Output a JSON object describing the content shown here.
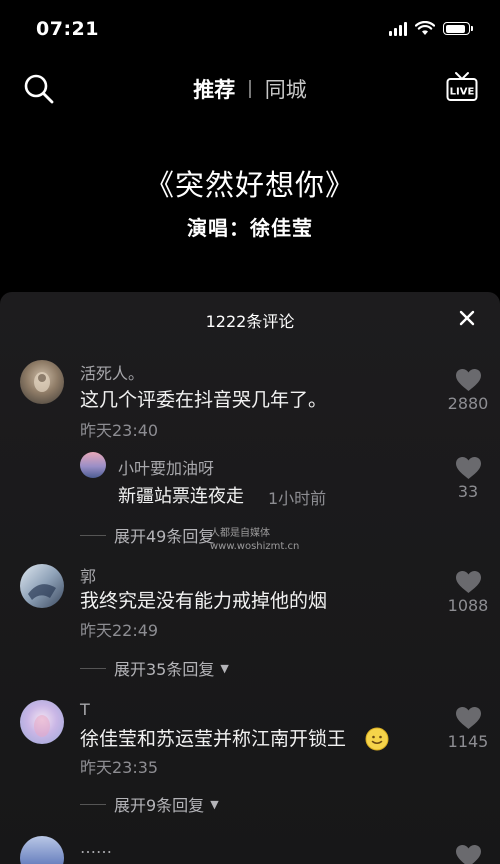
{
  "status_bar": {
    "time": "07:21",
    "battery_level": 0.9
  },
  "nav": {
    "tabs": [
      {
        "label": "推荐",
        "active": true
      },
      {
        "label": "同城",
        "active": false
      }
    ],
    "live_icon_text": "LIVE"
  },
  "song": {
    "title": "《突然好想你》",
    "singer": "演唱：徐佳莹"
  },
  "comments_panel": {
    "count_label": "1222条评论",
    "comments": [
      {
        "username": "活死人。",
        "text": "这几个评委在抖音哭几年了。",
        "time": "昨天23:40",
        "likes": "2880"
      },
      {
        "username": "小叶要加油呀",
        "text": "新疆站票连夜走",
        "time": "1小时前",
        "likes": "33"
      },
      {
        "username": "郭",
        "text": "我终究是没有能力戒掉他的烟",
        "time": "昨天22:49",
        "likes": "1088",
        "expand": "展开35条回复"
      },
      {
        "username": "T",
        "text": "徐佳莹和苏运莹并称江南开锁王",
        "time": "昨天23:35",
        "likes": "1145",
        "expand": "展开9条回复"
      },
      {
        "username": "……"
      }
    ],
    "first_expand": "展开49条回复"
  },
  "watermark": {
    "line1": "人都是自媒体",
    "line2": "www.woshizmt.cn"
  },
  "colors": {
    "background": "#000000",
    "sheet": "#1b1b1c",
    "secondary_text": "#8d8d92",
    "heart": "#6a6a6e"
  }
}
